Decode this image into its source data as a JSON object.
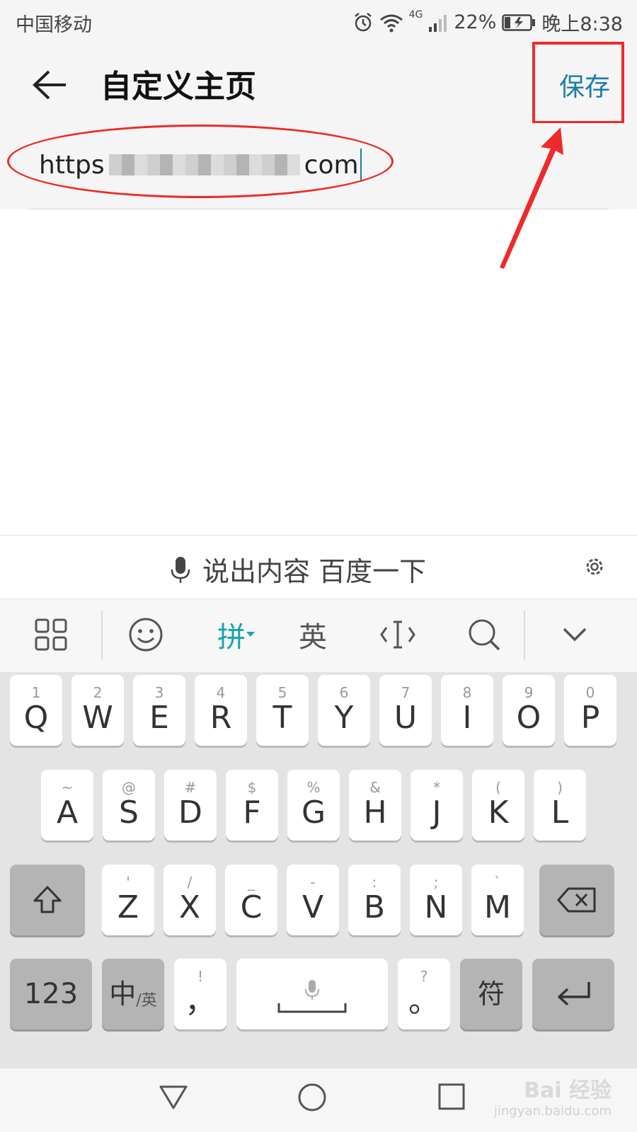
{
  "status_bar": {
    "carrier": "中国移动",
    "network": "4G",
    "battery": "22%",
    "time": "晚上8:38"
  },
  "app_bar": {
    "title": "自定义主页",
    "save_label": "保存"
  },
  "url_field": {
    "prefix": "https",
    "suffix": "com"
  },
  "voice_bar": {
    "hint": "说出内容 百度一下"
  },
  "kb_toolbar": {
    "pinyin_label": "拼",
    "english_label": "英"
  },
  "keyboard": {
    "row1": [
      {
        "hint": "1",
        "label": "Q"
      },
      {
        "hint": "2",
        "label": "W"
      },
      {
        "hint": "3",
        "label": "E"
      },
      {
        "hint": "4",
        "label": "R"
      },
      {
        "hint": "5",
        "label": "T"
      },
      {
        "hint": "6",
        "label": "Y"
      },
      {
        "hint": "7",
        "label": "U"
      },
      {
        "hint": "8",
        "label": "I"
      },
      {
        "hint": "9",
        "label": "O"
      },
      {
        "hint": "0",
        "label": "P"
      }
    ],
    "row2": [
      {
        "hint": "~",
        "label": "A"
      },
      {
        "hint": "@",
        "label": "S"
      },
      {
        "hint": "#",
        "label": "D"
      },
      {
        "hint": "$",
        "label": "F"
      },
      {
        "hint": "%",
        "label": "G"
      },
      {
        "hint": "&",
        "label": "H"
      },
      {
        "hint": "*",
        "label": "J"
      },
      {
        "hint": "(",
        "label": "K"
      },
      {
        "hint": ")",
        "label": "L"
      }
    ],
    "row3": [
      {
        "hint": "'",
        "label": "Z"
      },
      {
        "hint": "/",
        "label": "X"
      },
      {
        "hint": "_",
        "label": "C"
      },
      {
        "hint": "-",
        "label": "V"
      },
      {
        "hint": ":",
        "label": "B"
      },
      {
        "hint": ";",
        "label": "N"
      },
      {
        "hint": "`",
        "label": "M"
      }
    ],
    "numbers_label": "123",
    "lang_main": "中",
    "lang_sub": "/英",
    "comma_hint": "!",
    "comma_label": "，",
    "period_hint": "?",
    "period_label": "。",
    "symbols_label": "符"
  },
  "watermark": {
    "logo": "Bai 经验",
    "url": "jingyan.baidu.com"
  },
  "colors": {
    "accent": "#1a7ea4",
    "annotation": "#ee2a2a",
    "key_bg": "#ffffff",
    "fn_key_bg": "#b4b4b4"
  }
}
